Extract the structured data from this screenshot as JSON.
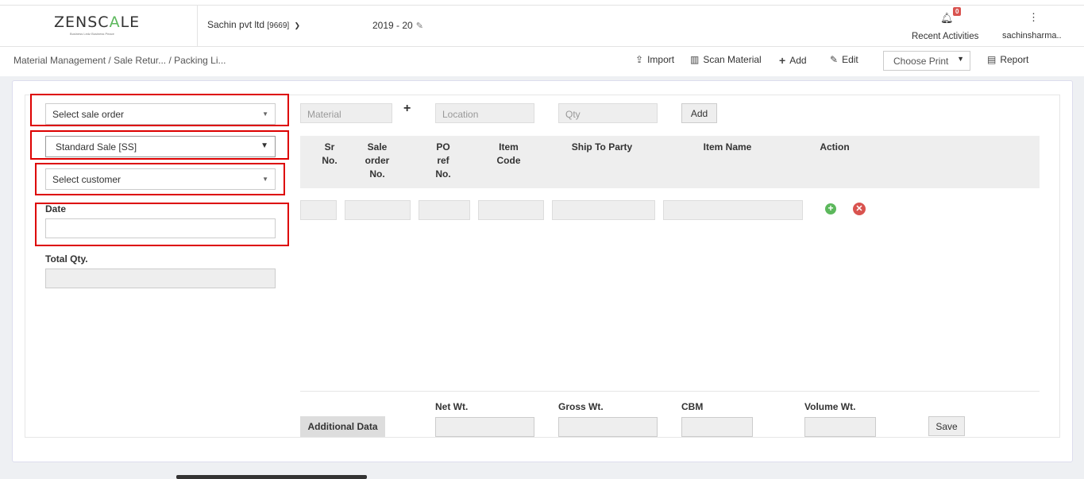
{
  "header": {
    "logo_prefix": "ZENSC",
    "logo_accent": "A",
    "logo_suffix": "LE",
    "logo_tagline": "Business Ledz Business Peace",
    "company_name": "Sachin pvt ltd",
    "company_code": "[9669]",
    "fiscal_year": "2019 - 20",
    "notification_count": "0",
    "recent_activities_label": "Recent Activities",
    "user_name": "sachinsharma.."
  },
  "breadcrumb": {
    "items": [
      "Material Management",
      "/ Sale Retur...",
      "/ Packing Li..."
    ]
  },
  "toolbar": {
    "import_label": "Import",
    "scan_label": "Scan Material",
    "add_label": "Add",
    "edit_label": "Edit",
    "print_selected": "Choose Print",
    "report_label": "Report"
  },
  "form": {
    "sale_order_placeholder": "Select sale order",
    "sale_type_value": "Standard Sale [SS]",
    "customer_placeholder": "Select customer",
    "date_label": "Date",
    "total_qty_label": "Total Qty."
  },
  "entry": {
    "material_placeholder": "Material",
    "location_placeholder": "Location",
    "qty_placeholder": "Qty",
    "add_button": "Add"
  },
  "table": {
    "columns": [
      "Sr No.",
      "Sale order No.",
      "PO ref No.",
      "Item Code",
      "Ship To Party",
      "Item Name",
      "Action"
    ]
  },
  "footer": {
    "additional_data_button": "Additional Data",
    "net_wt_label": "Net Wt.",
    "gross_wt_label": "Gross Wt.",
    "cbm_label": "CBM",
    "volume_wt_label": "Volume Wt.",
    "save_button": "Save"
  },
  "colors": {
    "accent_green": "#5cb85c",
    "danger_red": "#d9534f",
    "highlight_box": "#dd0000"
  }
}
